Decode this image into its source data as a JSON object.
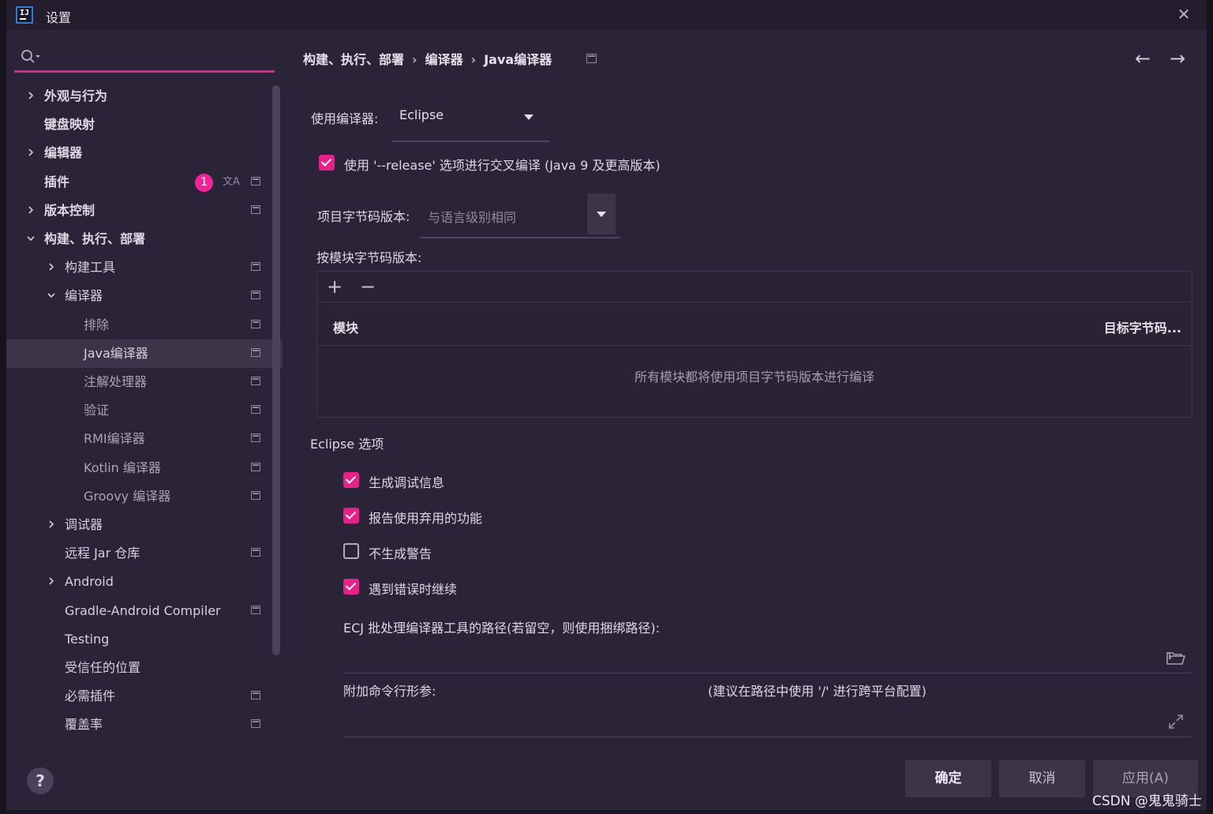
{
  "window": {
    "title": "设置"
  },
  "search": {
    "placeholder": ""
  },
  "sidebar": {
    "items": [
      {
        "label": "外观与行为",
        "chevron": "right",
        "indent": 0,
        "bold": true,
        "icon": false
      },
      {
        "label": "键盘映射",
        "chevron": "none",
        "indent": 0,
        "bold": true,
        "icon": false
      },
      {
        "label": "编辑器",
        "chevron": "right",
        "indent": 0,
        "bold": true,
        "icon": false
      },
      {
        "label": "插件",
        "chevron": "none",
        "indent": 0,
        "bold": true,
        "icon": true,
        "badge": "1"
      },
      {
        "label": "版本控制",
        "chevron": "right",
        "indent": 0,
        "bold": true,
        "icon": true
      },
      {
        "label": "构建、执行、部署",
        "chevron": "down",
        "indent": 0,
        "bold": true,
        "icon": false
      },
      {
        "label": "构建工具",
        "chevron": "right",
        "indent": 1,
        "bold": false,
        "icon": true
      },
      {
        "label": "编译器",
        "chevron": "down",
        "indent": 1,
        "bold": false,
        "icon": true
      },
      {
        "label": "排除",
        "chevron": "none",
        "indent": 2,
        "bold": false,
        "icon": true
      },
      {
        "label": "Java编译器",
        "chevron": "none",
        "indent": 2,
        "bold": false,
        "icon": true,
        "selected": true
      },
      {
        "label": "注解处理器",
        "chevron": "none",
        "indent": 2,
        "bold": false,
        "icon": true
      },
      {
        "label": "验证",
        "chevron": "none",
        "indent": 2,
        "bold": false,
        "icon": true
      },
      {
        "label": "RMI编译器",
        "chevron": "none",
        "indent": 2,
        "bold": false,
        "icon": true
      },
      {
        "label": "Kotlin 编译器",
        "chevron": "none",
        "indent": 2,
        "bold": false,
        "icon": true
      },
      {
        "label": "Groovy 编译器",
        "chevron": "none",
        "indent": 2,
        "bold": false,
        "icon": true
      },
      {
        "label": "调试器",
        "chevron": "right",
        "indent": 1,
        "bold": false,
        "icon": false
      },
      {
        "label": "远程 Jar 仓库",
        "chevron": "none",
        "indent": 1,
        "bold": false,
        "icon": true
      },
      {
        "label": "Android",
        "chevron": "right",
        "indent": 1,
        "bold": false,
        "icon": false
      },
      {
        "label": "Gradle-Android Compiler",
        "chevron": "none",
        "indent": 1,
        "bold": false,
        "icon": true
      },
      {
        "label": "Testing",
        "chevron": "none",
        "indent": 1,
        "bold": false,
        "icon": false
      },
      {
        "label": "受信任的位置",
        "chevron": "none",
        "indent": 1,
        "bold": false,
        "icon": false
      },
      {
        "label": "必需插件",
        "chevron": "none",
        "indent": 1,
        "bold": false,
        "icon": true
      },
      {
        "label": "覆盖率",
        "chevron": "none",
        "indent": 1,
        "bold": false,
        "icon": true
      }
    ],
    "help_label": "?"
  },
  "breadcrumb": {
    "parts": [
      "构建、执行、部署",
      "编译器",
      "Java编译器"
    ],
    "separator": "›"
  },
  "nav": {
    "back": "←",
    "forward": "→"
  },
  "compiler": {
    "label": "使用编译器:",
    "value": "Eclipse",
    "release_option_label": "使用 '--release' 选项进行交叉编译 (Java 9 及更高版本)",
    "release_option_checked": true
  },
  "bytecode": {
    "label": "项目字节码版本:",
    "placeholder": "与语言级别相同",
    "per_module_label": "按模块字节码版本:",
    "add_label": "+",
    "remove_label": "−",
    "col_module": "模块",
    "col_target": "目标字节码...",
    "empty_message": "所有模块都将使用项目字节码版本进行编译"
  },
  "eclipse": {
    "section_label": "Eclipse 选项",
    "options": [
      {
        "label": "生成调试信息",
        "checked": true
      },
      {
        "label": "报告使用弃用的功能",
        "checked": true
      },
      {
        "label": "不生成警告",
        "checked": false
      },
      {
        "label": "遇到错误时继续",
        "checked": true
      }
    ],
    "ecj_path_label": "ECJ 批处理编译器工具的路径(若留空，则使用捆绑路径):",
    "ecj_path_value": "",
    "extra_args_label": "附加命令行形参:",
    "extra_args_hint": "(建议在路径中使用 '/' 进行跨平台配置)",
    "extra_args_value": ""
  },
  "buttons": {
    "ok": "确定",
    "cancel": "取消",
    "apply": "应用(A)"
  },
  "watermark": "CSDN @鬼鬼骑士",
  "colors": {
    "accent": "#e8208a",
    "background": "#2b2438",
    "selection": "#3c3449"
  }
}
